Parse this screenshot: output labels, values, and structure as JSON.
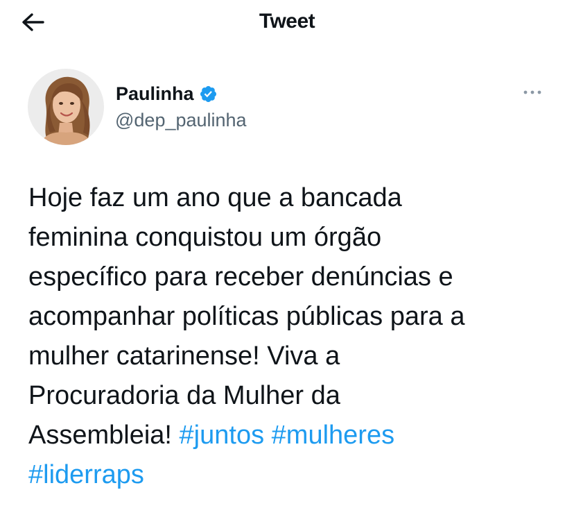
{
  "header": {
    "title": "Tweet",
    "back_icon": "arrow-left-icon"
  },
  "author": {
    "display_name": "Paulinha",
    "handle": "@dep_paulinha",
    "verified_icon": "verified-badge-icon",
    "avatar_icon": "avatar-photo",
    "more_icon": "more-horizontal-icon"
  },
  "tweet": {
    "line1": "Hoje faz um ano que a bancada",
    "line2": "feminina conquistou um órgão",
    "line3": "específico para receber denúncias e",
    "line4": "acompanhar políticas públicas para a",
    "line5": "mulher catarinense! Viva a",
    "line6": "Procuradoria da Mulher da",
    "line7_text": "Assembleia! ",
    "hashtags": [
      "#juntos",
      "#mulheres",
      "#liderraps"
    ]
  },
  "colors": {
    "accent": "#1d9bf0",
    "text": "#0f1419",
    "secondary": "#536471"
  }
}
